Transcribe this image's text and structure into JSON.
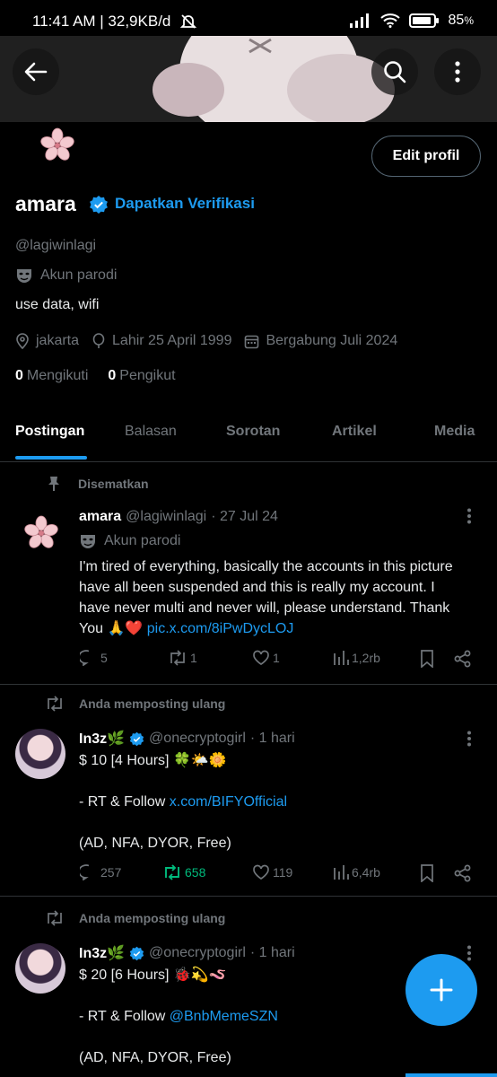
{
  "status_bar": {
    "time": "11:41 AM | 32,9KB/d",
    "battery": "85",
    "battery_unit": "%"
  },
  "header": {
    "back_icon": "arrow-left-icon",
    "search_icon": "search-icon",
    "more_icon": "more-vertical-icon"
  },
  "profile": {
    "avatar": "sakura-flower",
    "edit_button": "Edit profil",
    "name": "amara",
    "verify_link": "Dapatkan Verifikasi",
    "handle": "@lagiwinlagi",
    "parody_label": "Akun parodi",
    "bio": "use data, wifi",
    "location": "jakarta",
    "birth": "Lahir 25 April 1999",
    "joined": "Bergabung Juli 2024",
    "following_count": "0",
    "following_label": "Mengikuti",
    "followers_count": "0",
    "followers_label": "Pengikut"
  },
  "tabs": [
    "Postingan",
    "Balasan",
    "Sorotan",
    "Artikel",
    "Media"
  ],
  "tweets": [
    {
      "context": "Disematkan",
      "name": "amara",
      "handle": "@lagiwinlagi",
      "date": "· 27 Jul 24",
      "parody_label": "Akun parodi",
      "text": "I'm tired of everything, basically the accounts in this picture have all been suspended and this is really my account. I have never multi and never will, please understand. Thank You 🙏❤️",
      "link": "pic.x.com/8iPwDycLOJ",
      "replies": "5",
      "reposts": "1",
      "likes": "1",
      "views": "1,2rb"
    },
    {
      "context": "Anda memposting ulang",
      "name": "In3z🌿",
      "handle": "@onecryptogirl",
      "date": "· 1 hari",
      "line1": "$ 10  [4 Hours] 🍀🌤️🌼",
      "line2_prefix": "- RT & Follow ",
      "line2_link": "x.com/BIFYOfficial",
      "line3": "(AD, NFA, DYOR, Free)",
      "replies": "257",
      "reposts": "658",
      "likes": "119",
      "views": "6,4rb"
    },
    {
      "context": "Anda memposting ulang",
      "name": "In3z🌿",
      "handle": "@onecryptogirl",
      "date": "· 1 hari",
      "line1": "$ 20  [6 Hours] 🐞💫🪱",
      "line2_prefix": "- RT & Follow ",
      "line2_link": "@BnbMemeSZN",
      "line3": "(AD, NFA, DYOR, Free)"
    }
  ],
  "fab": {
    "icon": "plus-icon"
  },
  "colors": {
    "accent": "#1d9bf0",
    "repost_active": "#00ba7c",
    "muted": "#71767b"
  }
}
